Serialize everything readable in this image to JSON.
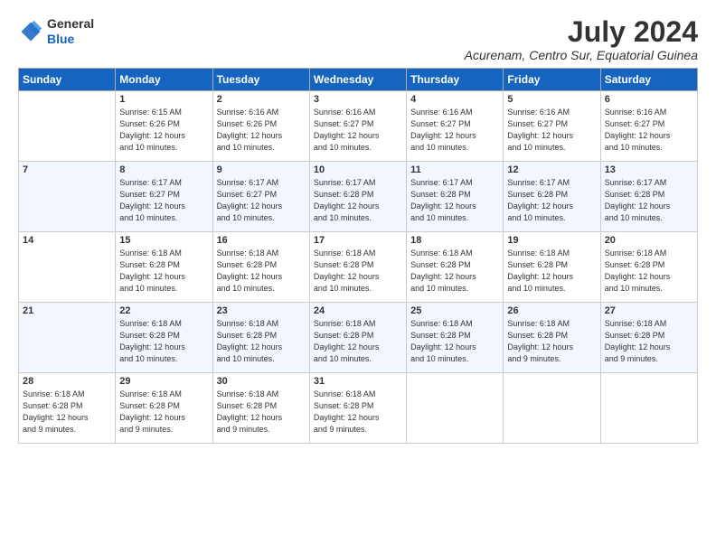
{
  "logo": {
    "general": "General",
    "blue": "Blue"
  },
  "header": {
    "month_year": "July 2024",
    "location": "Acurenam, Centro Sur, Equatorial Guinea"
  },
  "days_of_week": [
    "Sunday",
    "Monday",
    "Tuesday",
    "Wednesday",
    "Thursday",
    "Friday",
    "Saturday"
  ],
  "weeks": [
    [
      {
        "day": "",
        "info": ""
      },
      {
        "day": "1",
        "info": "Sunrise: 6:15 AM\nSunset: 6:26 PM\nDaylight: 12 hours\nand 10 minutes."
      },
      {
        "day": "2",
        "info": "Sunrise: 6:16 AM\nSunset: 6:26 PM\nDaylight: 12 hours\nand 10 minutes."
      },
      {
        "day": "3",
        "info": "Sunrise: 6:16 AM\nSunset: 6:27 PM\nDaylight: 12 hours\nand 10 minutes."
      },
      {
        "day": "4",
        "info": "Sunrise: 6:16 AM\nSunset: 6:27 PM\nDaylight: 12 hours\nand 10 minutes."
      },
      {
        "day": "5",
        "info": "Sunrise: 6:16 AM\nSunset: 6:27 PM\nDaylight: 12 hours\nand 10 minutes."
      },
      {
        "day": "6",
        "info": "Sunrise: 6:16 AM\nSunset: 6:27 PM\nDaylight: 12 hours\nand 10 minutes."
      }
    ],
    [
      {
        "day": "7",
        "info": ""
      },
      {
        "day": "8",
        "info": "Sunrise: 6:17 AM\nSunset: 6:27 PM\nDaylight: 12 hours\nand 10 minutes."
      },
      {
        "day": "9",
        "info": "Sunrise: 6:17 AM\nSunset: 6:27 PM\nDaylight: 12 hours\nand 10 minutes."
      },
      {
        "day": "10",
        "info": "Sunrise: 6:17 AM\nSunset: 6:28 PM\nDaylight: 12 hours\nand 10 minutes."
      },
      {
        "day": "11",
        "info": "Sunrise: 6:17 AM\nSunset: 6:28 PM\nDaylight: 12 hours\nand 10 minutes."
      },
      {
        "day": "12",
        "info": "Sunrise: 6:17 AM\nSunset: 6:28 PM\nDaylight: 12 hours\nand 10 minutes."
      },
      {
        "day": "13",
        "info": "Sunrise: 6:17 AM\nSunset: 6:28 PM\nDaylight: 12 hours\nand 10 minutes."
      }
    ],
    [
      {
        "day": "14",
        "info": ""
      },
      {
        "day": "15",
        "info": "Sunrise: 6:18 AM\nSunset: 6:28 PM\nDaylight: 12 hours\nand 10 minutes."
      },
      {
        "day": "16",
        "info": "Sunrise: 6:18 AM\nSunset: 6:28 PM\nDaylight: 12 hours\nand 10 minutes."
      },
      {
        "day": "17",
        "info": "Sunrise: 6:18 AM\nSunset: 6:28 PM\nDaylight: 12 hours\nand 10 minutes."
      },
      {
        "day": "18",
        "info": "Sunrise: 6:18 AM\nSunset: 6:28 PM\nDaylight: 12 hours\nand 10 minutes."
      },
      {
        "day": "19",
        "info": "Sunrise: 6:18 AM\nSunset: 6:28 PM\nDaylight: 12 hours\nand 10 minutes."
      },
      {
        "day": "20",
        "info": "Sunrise: 6:18 AM\nSunset: 6:28 PM\nDaylight: 12 hours\nand 10 minutes."
      }
    ],
    [
      {
        "day": "21",
        "info": ""
      },
      {
        "day": "22",
        "info": "Sunrise: 6:18 AM\nSunset: 6:28 PM\nDaylight: 12 hours\nand 10 minutes."
      },
      {
        "day": "23",
        "info": "Sunrise: 6:18 AM\nSunset: 6:28 PM\nDaylight: 12 hours\nand 10 minutes."
      },
      {
        "day": "24",
        "info": "Sunrise: 6:18 AM\nSunset: 6:28 PM\nDaylight: 12 hours\nand 10 minutes."
      },
      {
        "day": "25",
        "info": "Sunrise: 6:18 AM\nSunset: 6:28 PM\nDaylight: 12 hours\nand 10 minutes."
      },
      {
        "day": "26",
        "info": "Sunrise: 6:18 AM\nSunset: 6:28 PM\nDaylight: 12 hours\nand 9 minutes."
      },
      {
        "day": "27",
        "info": "Sunrise: 6:18 AM\nSunset: 6:28 PM\nDaylight: 12 hours\nand 9 minutes."
      }
    ],
    [
      {
        "day": "28",
        "info": "Sunrise: 6:18 AM\nSunset: 6:28 PM\nDaylight: 12 hours\nand 9 minutes."
      },
      {
        "day": "29",
        "info": "Sunrise: 6:18 AM\nSunset: 6:28 PM\nDaylight: 12 hours\nand 9 minutes."
      },
      {
        "day": "30",
        "info": "Sunrise: 6:18 AM\nSunset: 6:28 PM\nDaylight: 12 hours\nand 9 minutes."
      },
      {
        "day": "31",
        "info": "Sunrise: 6:18 AM\nSunset: 6:28 PM\nDaylight: 12 hours\nand 9 minutes."
      },
      {
        "day": "",
        "info": ""
      },
      {
        "day": "",
        "info": ""
      },
      {
        "day": "",
        "info": ""
      }
    ]
  ]
}
